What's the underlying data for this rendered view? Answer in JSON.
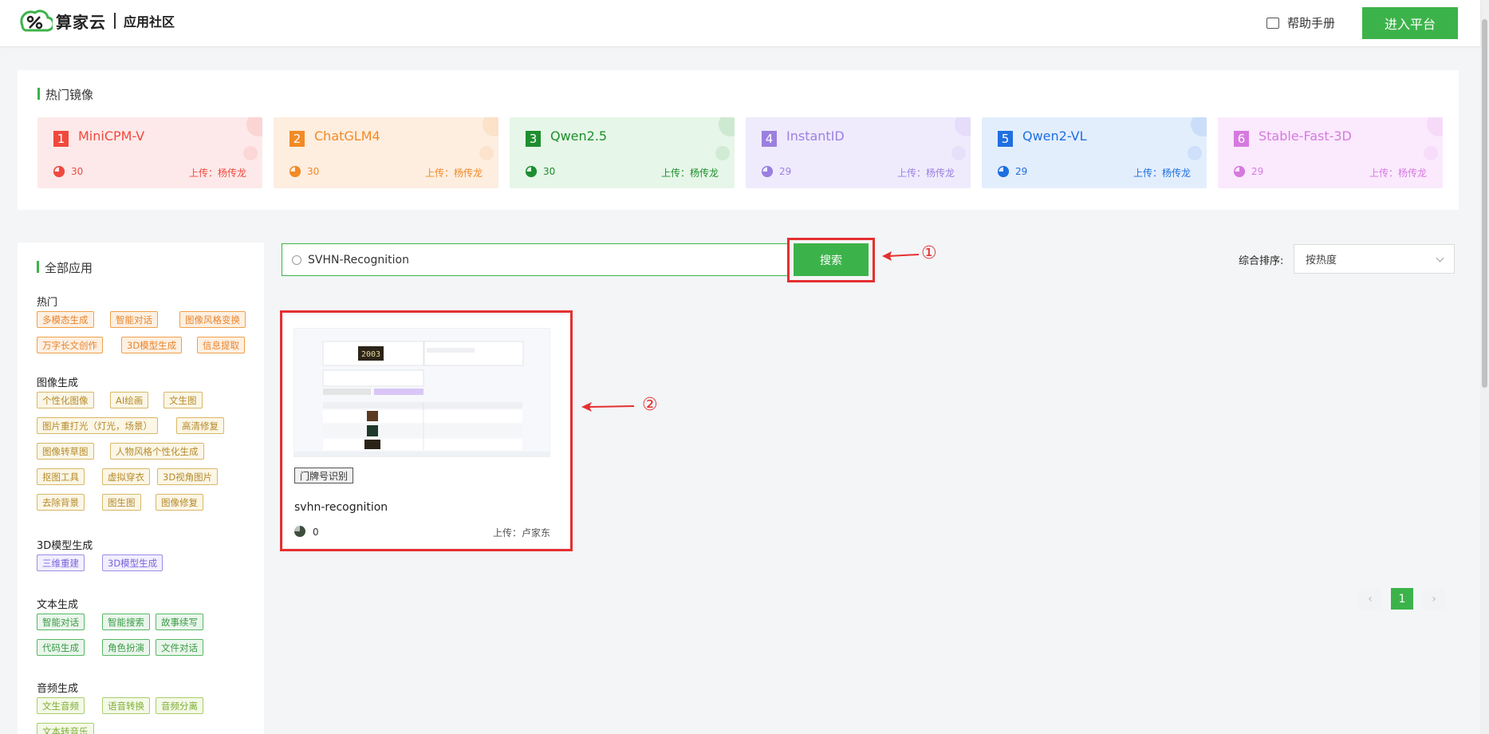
{
  "header": {
    "brand": "算家云",
    "subbrand": "应用社区",
    "help_label": "帮助手册",
    "enter_label": "进入平台"
  },
  "hot": {
    "title": "热门镜像",
    "cards": [
      {
        "rank": "1",
        "name": "MiniCPM-V",
        "views": "30",
        "uploader": "上传：杨传龙",
        "color": "#f0493e",
        "bg": "#fde9e9"
      },
      {
        "rank": "2",
        "name": "ChatGLM4",
        "views": "30",
        "uploader": "上传：杨传龙",
        "color": "#f28a25",
        "bg": "#fdeee0"
      },
      {
        "rank": "3",
        "name": "Qwen2.5",
        "views": "30",
        "uploader": "上传：杨传龙",
        "color": "#1e8e2e",
        "bg": "#e6f6e8"
      },
      {
        "rank": "4",
        "name": "InstantID",
        "views": "29",
        "uploader": "上传：杨传龙",
        "color": "#9b7fe0",
        "bg": "#efebfd"
      },
      {
        "rank": "5",
        "name": "Qwen2-VL",
        "views": "29",
        "uploader": "上传：杨传龙",
        "color": "#1f6fe0",
        "bg": "#e3eefd"
      },
      {
        "rank": "6",
        "name": "Stable-Fast-3D",
        "views": "29",
        "uploader": "上传：杨传龙",
        "color": "#d57adf",
        "bg": "#fbe9fd"
      }
    ]
  },
  "sidebar": {
    "title": "全部应用",
    "categories": [
      {
        "name": "热门",
        "tags": [
          "多模态生成",
          "智能对话",
          "图像风格变换",
          "万字长文创作",
          "3D模型生成",
          "信息提取"
        ]
      },
      {
        "name": "图像生成",
        "tags": [
          "个性化图像",
          "AI绘画",
          "文生图",
          "图片重打光（灯光，场景）",
          "高清修复",
          "图像转草图",
          "人物风格个性化生成",
          "抠图工具",
          "虚拟穿衣",
          "3D视角图片",
          "去除背景",
          "图生图",
          "图像修复"
        ]
      },
      {
        "name": "3D模型生成",
        "tags": [
          "三维重建",
          "3D模型生成"
        ]
      },
      {
        "name": "文本生成",
        "tags": [
          "智能对话",
          "智能搜索",
          "故事续写",
          "代码生成",
          "角色扮演",
          "文件对话"
        ]
      },
      {
        "name": "音频生成",
        "tags": [
          "文生音频",
          "语音转换",
          "音频分离",
          "文本转音乐"
        ]
      }
    ]
  },
  "search": {
    "value": "SVHN-Recognition",
    "button_label": "搜索"
  },
  "sort": {
    "label": "综合排序:",
    "selected": "按热度"
  },
  "results": [
    {
      "tag": "门牌号识别",
      "name": "svhn-recognition",
      "views": "0",
      "uploader": "上传：卢家东"
    }
  ],
  "pagination": {
    "prev": "‹",
    "current": "1",
    "next": "›"
  },
  "annotations": {
    "one": "①",
    "two": "②"
  },
  "colors": {
    "accent": "#3cb34a",
    "highlight": "#e53030"
  }
}
